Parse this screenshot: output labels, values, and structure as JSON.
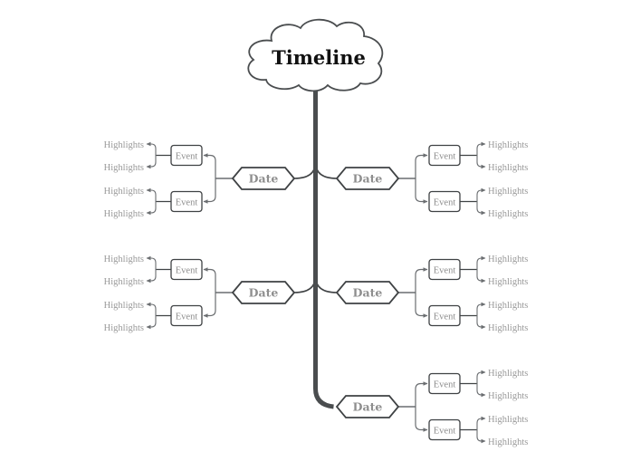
{
  "diagram": {
    "type": "timeline-mindmap",
    "colors": {
      "trunk": "#4a4d4f",
      "node_border": "#3f4244",
      "connector": "#6a6d70",
      "secondary_text": "#8e8e8e",
      "root_text": "#111111",
      "background": "#ffffff"
    },
    "root": {
      "label": "Timeline",
      "shape": "cloud"
    },
    "dates": [
      {
        "label": "Date",
        "side": "left",
        "row": 1,
        "events": [
          {
            "label": "Event",
            "highlights": [
              "Highlights",
              "Highlights"
            ]
          },
          {
            "label": "Event",
            "highlights": [
              "Highlights",
              "Highlights"
            ]
          }
        ]
      },
      {
        "label": "Date",
        "side": "right",
        "row": 1,
        "events": [
          {
            "label": "Event",
            "highlights": [
              "Highlights",
              "Highlights"
            ]
          },
          {
            "label": "Event",
            "highlights": [
              "Highlights",
              "Highlights"
            ]
          }
        ]
      },
      {
        "label": "Date",
        "side": "left",
        "row": 2,
        "events": [
          {
            "label": "Event",
            "highlights": [
              "Highlights",
              "Highlights"
            ]
          },
          {
            "label": "Event",
            "highlights": [
              "Highlights",
              "Highlights"
            ]
          }
        ]
      },
      {
        "label": "Date",
        "side": "right",
        "row": 2,
        "events": [
          {
            "label": "Event",
            "highlights": [
              "Highlights",
              "Highlights"
            ]
          },
          {
            "label": "Event",
            "highlights": [
              "Highlights",
              "Highlights"
            ]
          }
        ]
      },
      {
        "label": "Date",
        "side": "right",
        "row": 3,
        "events": [
          {
            "label": "Event",
            "highlights": [
              "Highlights",
              "Highlights"
            ]
          },
          {
            "label": "Event",
            "highlights": [
              "Highlights",
              "Highlights"
            ]
          }
        ]
      }
    ]
  }
}
